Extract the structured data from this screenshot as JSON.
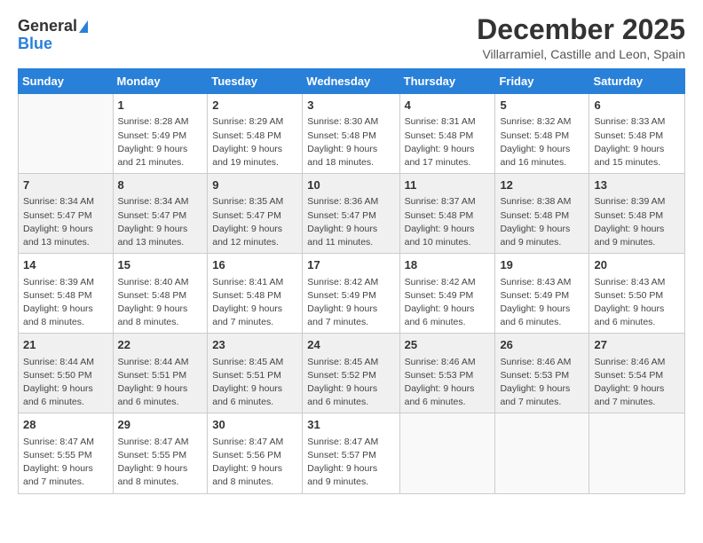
{
  "logo": {
    "general": "General",
    "blue": "Blue"
  },
  "title": {
    "month_year": "December 2025",
    "location": "Villarramiel, Castille and Leon, Spain"
  },
  "headers": [
    "Sunday",
    "Monday",
    "Tuesday",
    "Wednesday",
    "Thursday",
    "Friday",
    "Saturday"
  ],
  "weeks": [
    [
      {
        "day": "",
        "info": ""
      },
      {
        "day": "1",
        "info": "Sunrise: 8:28 AM\nSunset: 5:49 PM\nDaylight: 9 hours\nand 21 minutes."
      },
      {
        "day": "2",
        "info": "Sunrise: 8:29 AM\nSunset: 5:48 PM\nDaylight: 9 hours\nand 19 minutes."
      },
      {
        "day": "3",
        "info": "Sunrise: 8:30 AM\nSunset: 5:48 PM\nDaylight: 9 hours\nand 18 minutes."
      },
      {
        "day": "4",
        "info": "Sunrise: 8:31 AM\nSunset: 5:48 PM\nDaylight: 9 hours\nand 17 minutes."
      },
      {
        "day": "5",
        "info": "Sunrise: 8:32 AM\nSunset: 5:48 PM\nDaylight: 9 hours\nand 16 minutes."
      },
      {
        "day": "6",
        "info": "Sunrise: 8:33 AM\nSunset: 5:48 PM\nDaylight: 9 hours\nand 15 minutes."
      }
    ],
    [
      {
        "day": "7",
        "info": "Sunrise: 8:34 AM\nSunset: 5:47 PM\nDaylight: 9 hours\nand 13 minutes."
      },
      {
        "day": "8",
        "info": "Sunrise: 8:34 AM\nSunset: 5:47 PM\nDaylight: 9 hours\nand 13 minutes."
      },
      {
        "day": "9",
        "info": "Sunrise: 8:35 AM\nSunset: 5:47 PM\nDaylight: 9 hours\nand 12 minutes."
      },
      {
        "day": "10",
        "info": "Sunrise: 8:36 AM\nSunset: 5:47 PM\nDaylight: 9 hours\nand 11 minutes."
      },
      {
        "day": "11",
        "info": "Sunrise: 8:37 AM\nSunset: 5:48 PM\nDaylight: 9 hours\nand 10 minutes."
      },
      {
        "day": "12",
        "info": "Sunrise: 8:38 AM\nSunset: 5:48 PM\nDaylight: 9 hours\nand 9 minutes."
      },
      {
        "day": "13",
        "info": "Sunrise: 8:39 AM\nSunset: 5:48 PM\nDaylight: 9 hours\nand 9 minutes."
      }
    ],
    [
      {
        "day": "14",
        "info": "Sunrise: 8:39 AM\nSunset: 5:48 PM\nDaylight: 9 hours\nand 8 minutes."
      },
      {
        "day": "15",
        "info": "Sunrise: 8:40 AM\nSunset: 5:48 PM\nDaylight: 9 hours\nand 8 minutes."
      },
      {
        "day": "16",
        "info": "Sunrise: 8:41 AM\nSunset: 5:48 PM\nDaylight: 9 hours\nand 7 minutes."
      },
      {
        "day": "17",
        "info": "Sunrise: 8:42 AM\nSunset: 5:49 PM\nDaylight: 9 hours\nand 7 minutes."
      },
      {
        "day": "18",
        "info": "Sunrise: 8:42 AM\nSunset: 5:49 PM\nDaylight: 9 hours\nand 6 minutes."
      },
      {
        "day": "19",
        "info": "Sunrise: 8:43 AM\nSunset: 5:49 PM\nDaylight: 9 hours\nand 6 minutes."
      },
      {
        "day": "20",
        "info": "Sunrise: 8:43 AM\nSunset: 5:50 PM\nDaylight: 9 hours\nand 6 minutes."
      }
    ],
    [
      {
        "day": "21",
        "info": "Sunrise: 8:44 AM\nSunset: 5:50 PM\nDaylight: 9 hours\nand 6 minutes."
      },
      {
        "day": "22",
        "info": "Sunrise: 8:44 AM\nSunset: 5:51 PM\nDaylight: 9 hours\nand 6 minutes."
      },
      {
        "day": "23",
        "info": "Sunrise: 8:45 AM\nSunset: 5:51 PM\nDaylight: 9 hours\nand 6 minutes."
      },
      {
        "day": "24",
        "info": "Sunrise: 8:45 AM\nSunset: 5:52 PM\nDaylight: 9 hours\nand 6 minutes."
      },
      {
        "day": "25",
        "info": "Sunrise: 8:46 AM\nSunset: 5:53 PM\nDaylight: 9 hours\nand 6 minutes."
      },
      {
        "day": "26",
        "info": "Sunrise: 8:46 AM\nSunset: 5:53 PM\nDaylight: 9 hours\nand 7 minutes."
      },
      {
        "day": "27",
        "info": "Sunrise: 8:46 AM\nSunset: 5:54 PM\nDaylight: 9 hours\nand 7 minutes."
      }
    ],
    [
      {
        "day": "28",
        "info": "Sunrise: 8:47 AM\nSunset: 5:55 PM\nDaylight: 9 hours\nand 7 minutes."
      },
      {
        "day": "29",
        "info": "Sunrise: 8:47 AM\nSunset: 5:55 PM\nDaylight: 9 hours\nand 8 minutes."
      },
      {
        "day": "30",
        "info": "Sunrise: 8:47 AM\nSunset: 5:56 PM\nDaylight: 9 hours\nand 8 minutes."
      },
      {
        "day": "31",
        "info": "Sunrise: 8:47 AM\nSunset: 5:57 PM\nDaylight: 9 hours\nand 9 minutes."
      },
      {
        "day": "",
        "info": ""
      },
      {
        "day": "",
        "info": ""
      },
      {
        "day": "",
        "info": ""
      }
    ]
  ]
}
